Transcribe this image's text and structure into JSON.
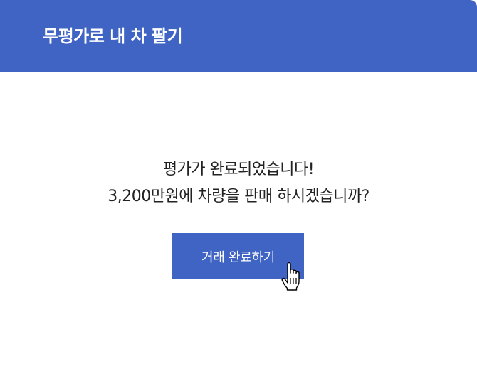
{
  "header": {
    "title": "무평가로 내 차 팔기"
  },
  "message": {
    "line1": "평가가 완료되었습니다!",
    "line2": "3,200만원에 차량을 판매 하시겠습니까?"
  },
  "actions": {
    "confirm_label": "거래 완료하기"
  },
  "colors": {
    "accent": "#4064c3",
    "text": "#222222"
  },
  "icons": {
    "cursor": "hand-pointer-icon"
  }
}
